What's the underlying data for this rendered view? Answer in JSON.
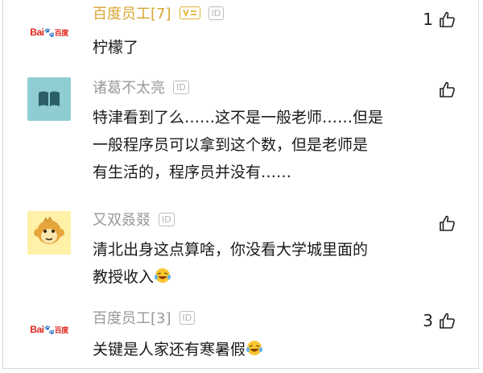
{
  "comments": [
    {
      "avatar": "baidu-logo",
      "username": "百度员工[7]",
      "has_level_badge": true,
      "id_badge": "ID",
      "text": "柠檬了",
      "likes": "1"
    },
    {
      "avatar": "book-icon",
      "username": "诸葛不太亮",
      "id_badge": "ID",
      "text_lines": [
        "特津看到了么……这不是一般老师……但是",
        "一般程序员可以拿到这个数，但是老师是",
        "有生活的，程序员并没有……"
      ],
      "likes": ""
    },
    {
      "avatar": "monkey-icon",
      "username": "又双叒叕",
      "id_badge": "ID",
      "text_lines": [
        "清北出身这点算啥，你没看大学城里面的",
        "教授收入"
      ],
      "likes": ""
    },
    {
      "avatar": "baidu-logo",
      "username": "百度员工[3]",
      "id_badge": "ID",
      "text": "关键是人家还有寒暑假",
      "likes": "3"
    }
  ],
  "baidu_logo": {
    "part1": "Bai",
    "part2": "百度"
  },
  "colors": {
    "username_gold": "#d8a531",
    "username_gray": "#999999",
    "book_avatar_bg": "#8fcdd2",
    "monkey_avatar_bg": "#fff1a8",
    "baidu_red": "#e0261c",
    "baidu_blue": "#2f64d8"
  }
}
